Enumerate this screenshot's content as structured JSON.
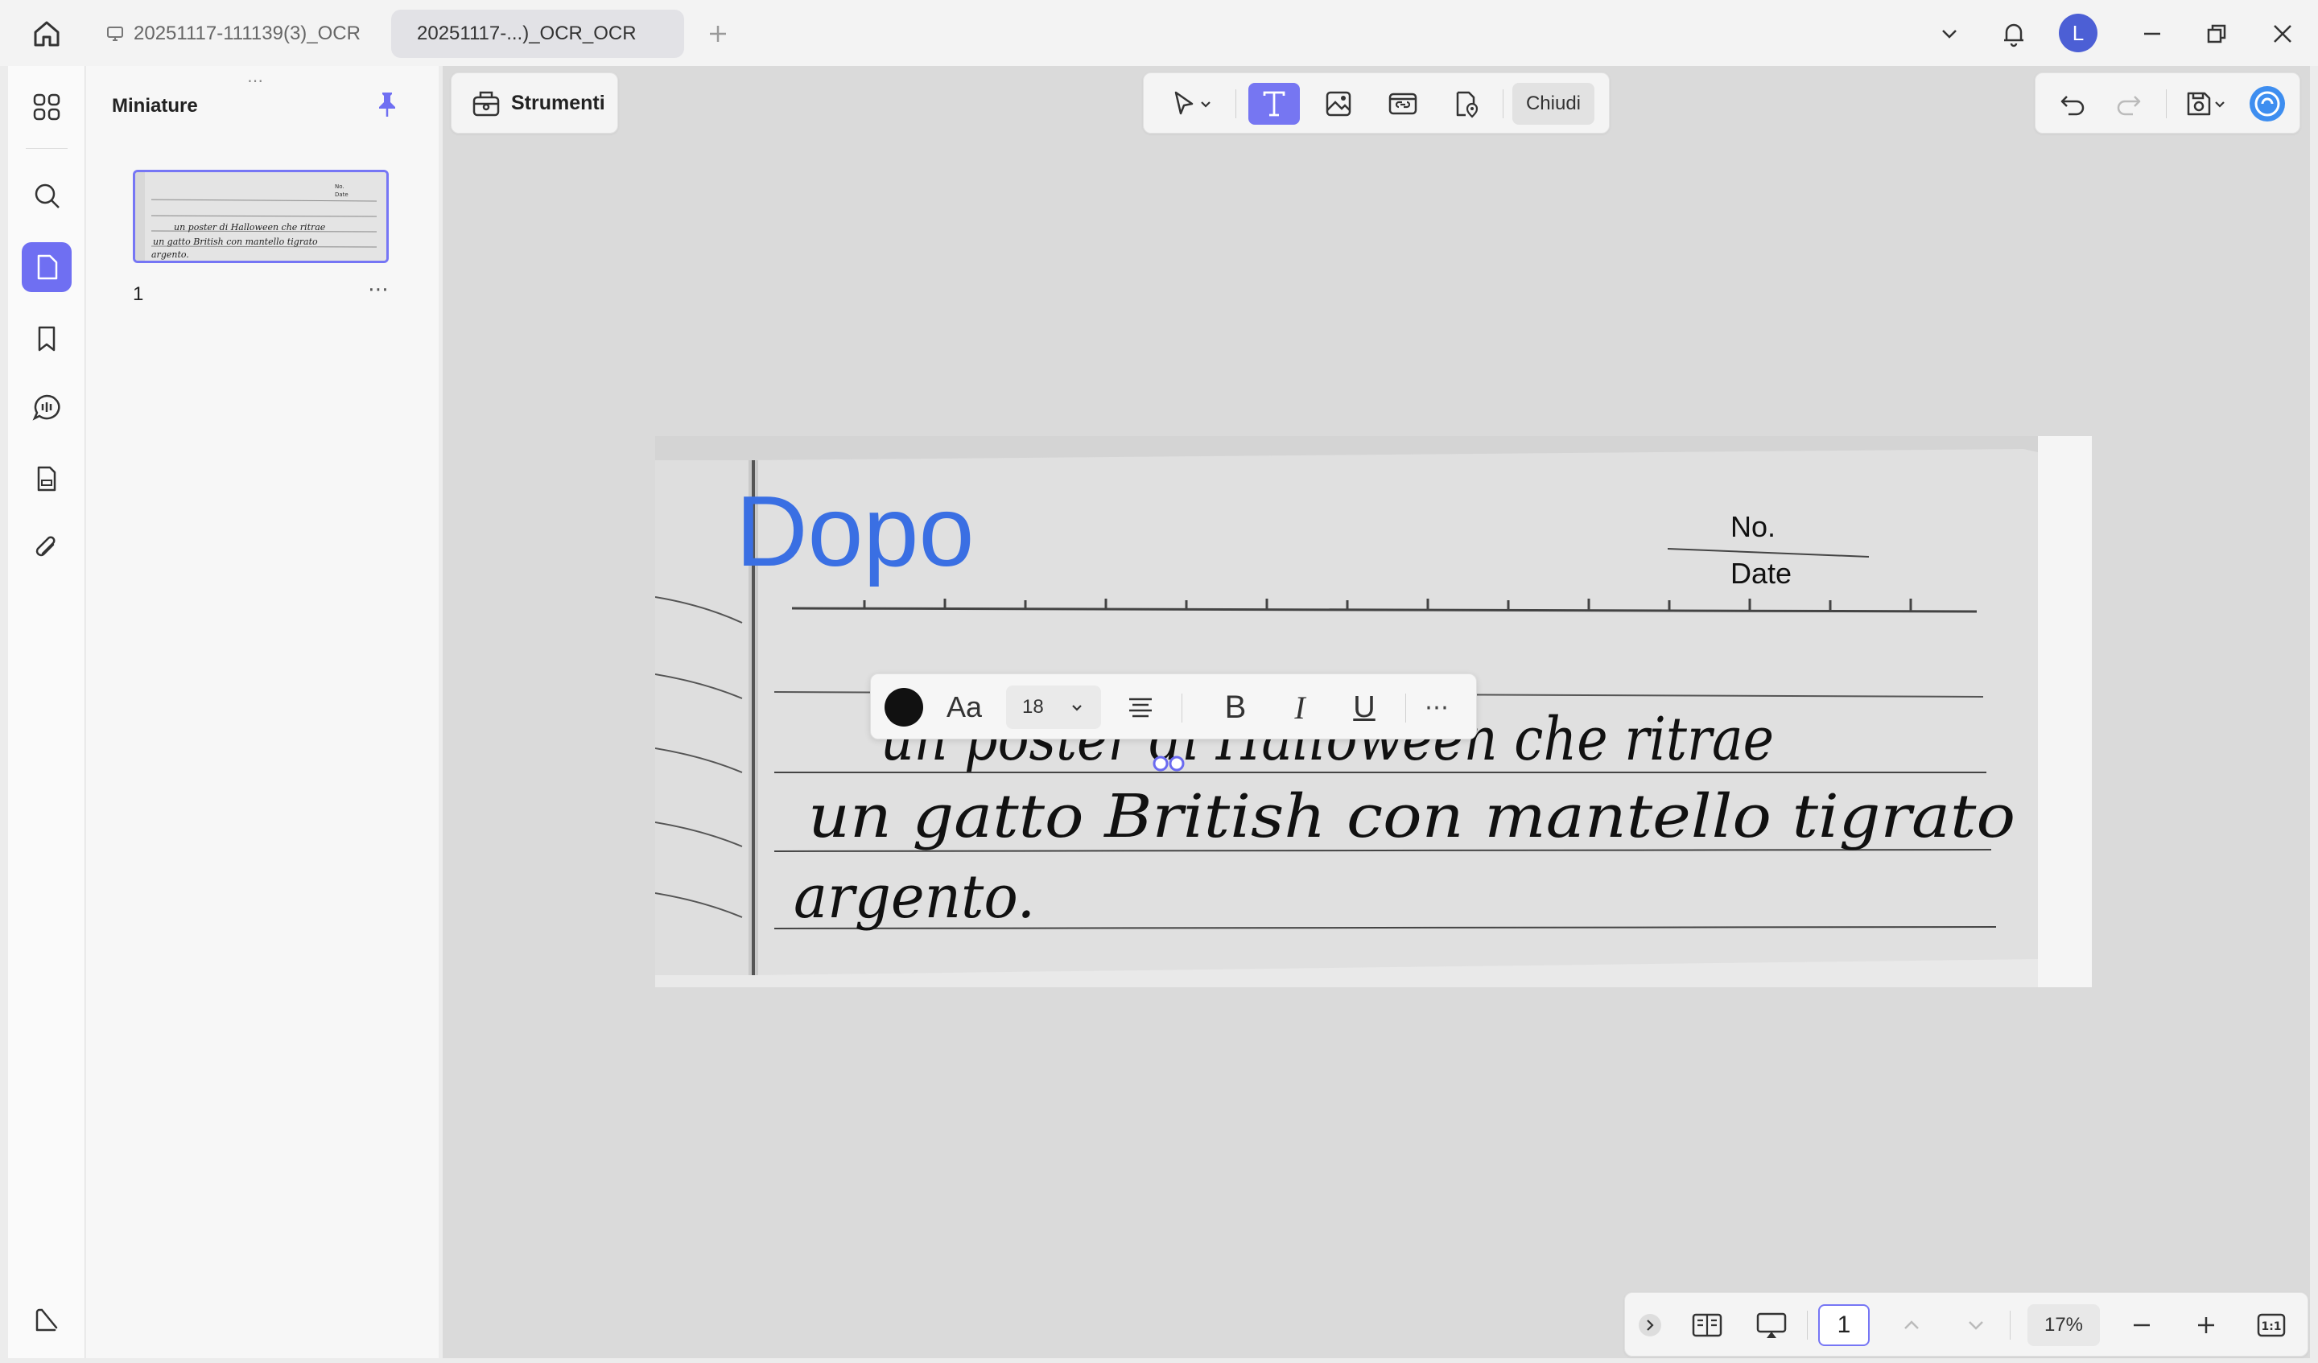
{
  "tabs": [
    {
      "title": "20251117-111139(3)_OCR"
    },
    {
      "title": "20251117-...)_OCR_OCR"
    }
  ],
  "user": {
    "initial": "L"
  },
  "sidebar": {
    "title": "Miniature",
    "grip": "⋯",
    "thumbnails": [
      {
        "label": "1",
        "more": "⋯"
      }
    ]
  },
  "toolbar": {
    "strumenti_label": "Strumenti",
    "close_label": "Chiudi"
  },
  "page": {
    "added_text": "Dopo",
    "header_no": "No.",
    "header_date": "Date",
    "handwriting_lines": [
      "un poster di Halloween che ritrae",
      "un gatto British con mantello tigrato",
      "argento."
    ]
  },
  "format_toolbar": {
    "font_icon_label": "Aa",
    "font_size": "18",
    "bold": "B",
    "italic": "I",
    "underline": "U",
    "more": "⋯"
  },
  "bottom_bar": {
    "page_number": "1",
    "zoom": "17%",
    "fit_label": "1:1"
  },
  "colors": {
    "accent": "#7676f5",
    "added_text": "#3a6fe3",
    "avatar": "#4c5fd5"
  }
}
